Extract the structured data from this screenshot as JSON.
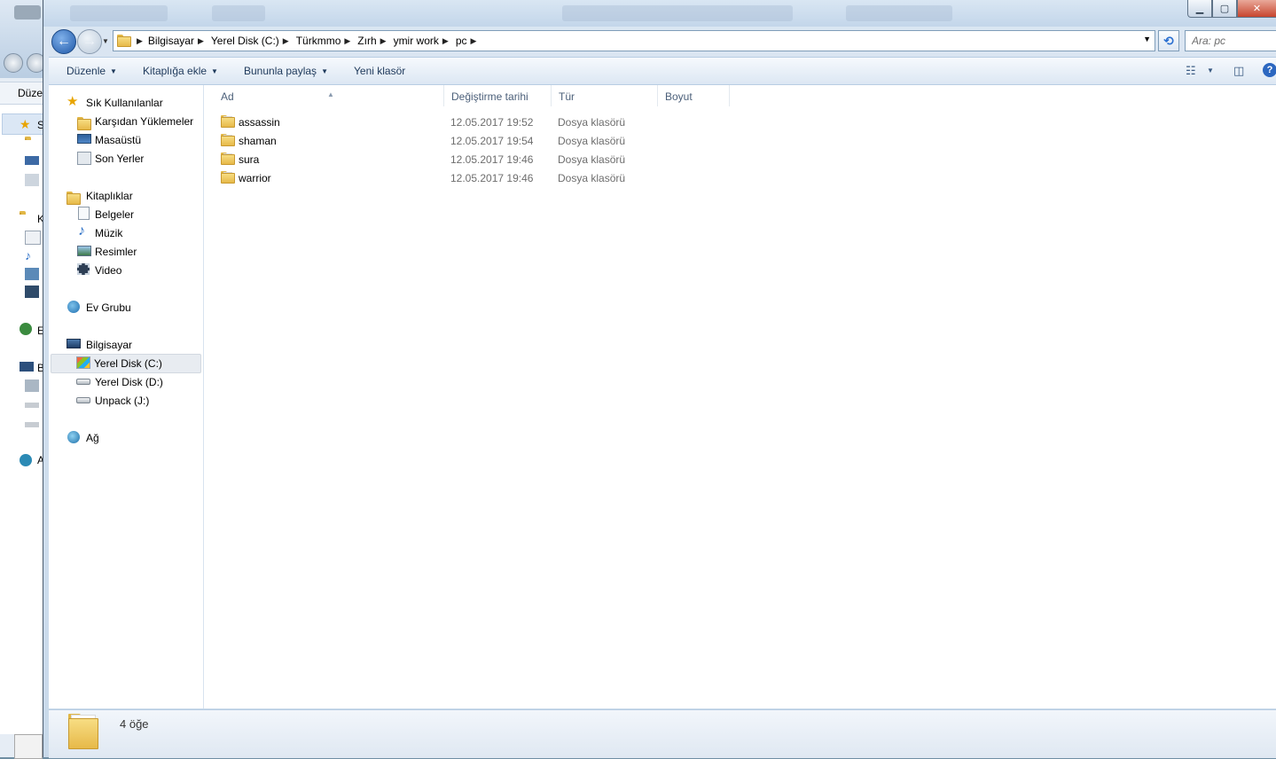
{
  "background_window": {
    "menu_label": "Düzen",
    "left_letters": [
      "S",
      "K",
      "E",
      "B",
      "A"
    ]
  },
  "breadcrumb": [
    {
      "label": "Bilgisayar"
    },
    {
      "label": "Yerel Disk (C:)"
    },
    {
      "label": "Türkmmo"
    },
    {
      "label": "Zırh"
    },
    {
      "label": "ymir work"
    },
    {
      "label": "pc"
    }
  ],
  "search": {
    "placeholder": "Ara: pc"
  },
  "toolbar": {
    "organize": "Düzenle",
    "add_to_library": "Kitaplığa ekle",
    "share_with": "Bununla paylaş",
    "new_folder": "Yeni klasör"
  },
  "nav": {
    "favorites": {
      "label": "Sık Kullanılanlar",
      "items": [
        {
          "label": "Karşıdan Yüklemeler",
          "icon": "downloads-icon"
        },
        {
          "label": "Masaüstü",
          "icon": "desktop-icon"
        },
        {
          "label": "Son Yerler",
          "icon": "recent-places-icon"
        }
      ]
    },
    "libraries": {
      "label": "Kitaplıklar",
      "items": [
        {
          "label": "Belgeler",
          "icon": "documents-icon"
        },
        {
          "label": "Müzik",
          "icon": "music-icon"
        },
        {
          "label": "Resimler",
          "icon": "pictures-icon"
        },
        {
          "label": "Video",
          "icon": "video-icon"
        }
      ]
    },
    "homegroup": {
      "label": "Ev Grubu"
    },
    "computer": {
      "label": "Bilgisayar",
      "items": [
        {
          "label": "Yerel Disk (C:)",
          "icon": "system-drive-icon",
          "selected": true
        },
        {
          "label": "Yerel Disk (D:)",
          "icon": "drive-icon"
        },
        {
          "label": "Unpack (J:)",
          "icon": "drive-icon"
        }
      ]
    },
    "network": {
      "label": "Ağ"
    }
  },
  "columns": {
    "name": "Ad",
    "modified": "Değiştirme tarihi",
    "type": "Tür",
    "size": "Boyut"
  },
  "files": [
    {
      "name": "assassin",
      "modified": "12.05.2017 19:52",
      "type": "Dosya klasörü"
    },
    {
      "name": "shaman",
      "modified": "12.05.2017 19:54",
      "type": "Dosya klasörü"
    },
    {
      "name": "sura",
      "modified": "12.05.2017 19:46",
      "type": "Dosya klasörü"
    },
    {
      "name": "warrior",
      "modified": "12.05.2017 19:46",
      "type": "Dosya klasörü"
    }
  ],
  "details": {
    "item_count": "4 öğe"
  }
}
